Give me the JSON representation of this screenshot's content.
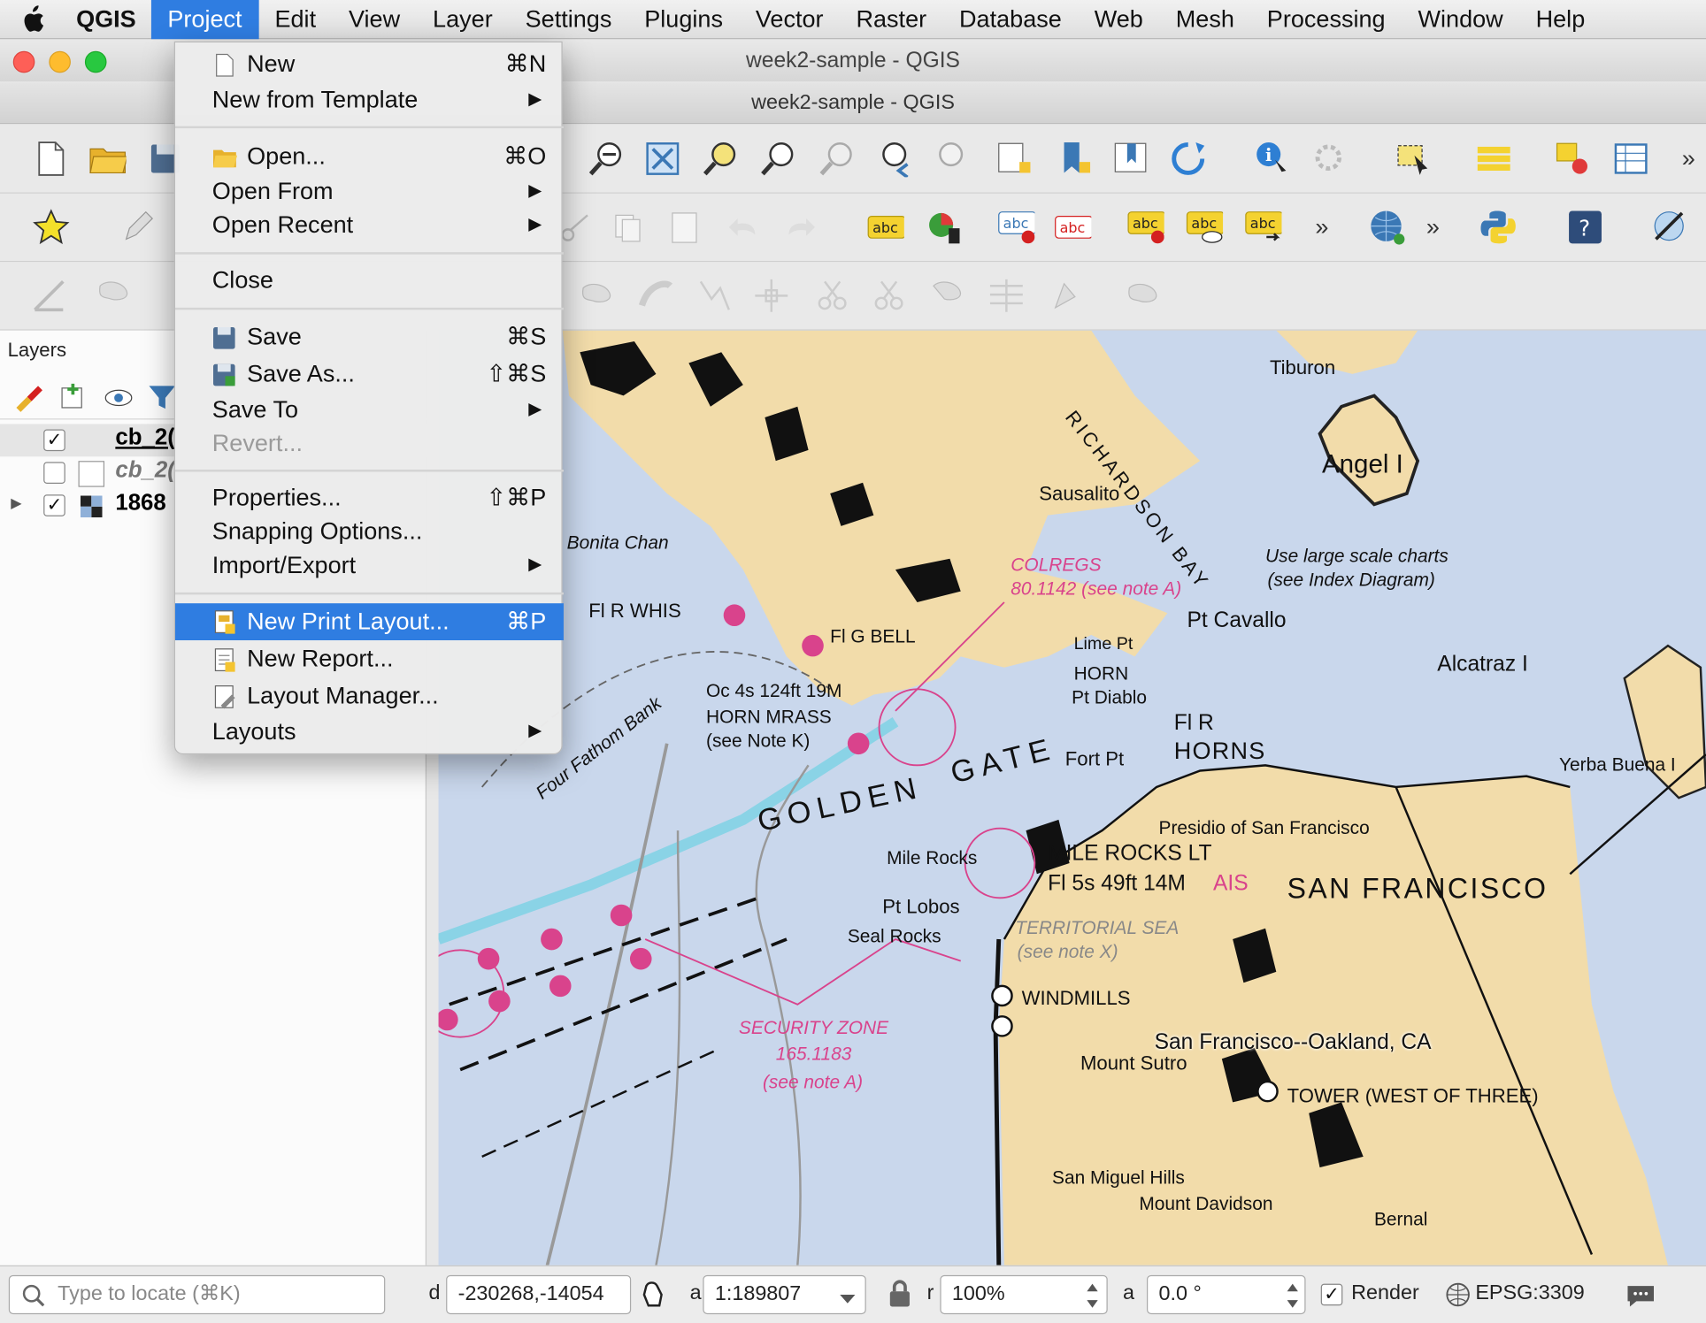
{
  "menubar": {
    "app_name": "QGIS",
    "items": [
      "Project",
      "Edit",
      "View",
      "Layer",
      "Settings",
      "Plugins",
      "Vector",
      "Raster",
      "Database",
      "Web",
      "Mesh",
      "Processing",
      "Window",
      "Help"
    ]
  },
  "window": {
    "title": "week2-sample - QGIS",
    "subtitle": "week2-sample - QGIS"
  },
  "project_menu": {
    "new": {
      "label": "New",
      "shortcut": "⌘N"
    },
    "new_from_template": {
      "label": "New from Template"
    },
    "open": {
      "label": "Open...",
      "shortcut": "⌘O"
    },
    "open_from": {
      "label": "Open From"
    },
    "open_recent": {
      "label": "Open Recent"
    },
    "close": {
      "label": "Close"
    },
    "save": {
      "label": "Save",
      "shortcut": "⌘S"
    },
    "save_as": {
      "label": "Save As...",
      "shortcut": "⇧⌘S"
    },
    "save_to": {
      "label": "Save To"
    },
    "revert": {
      "label": "Revert..."
    },
    "properties": {
      "label": "Properties...",
      "shortcut": "⇧⌘P"
    },
    "snapping": {
      "label": "Snapping Options..."
    },
    "import_export": {
      "label": "Import/Export"
    },
    "new_print_layout": {
      "label": "New Print Layout...",
      "shortcut": "⌘P"
    },
    "new_report": {
      "label": "New Report..."
    },
    "layout_manager": {
      "label": "Layout Manager..."
    },
    "layouts": {
      "label": "Layouts"
    },
    "submenu_arrow": "▶"
  },
  "layers": {
    "title": "Layers",
    "items": [
      {
        "name": "cb_2(",
        "checked": "✓"
      },
      {
        "name": "cb_2(",
        "checked": ""
      },
      {
        "name": "1868",
        "checked": "✓",
        "expander": "▶"
      }
    ]
  },
  "map": {
    "labels": {
      "golden": "GOLDEN",
      "gate": "GATE",
      "sf": "SAN FRANCISCO",
      "place": "San Francisco--Oakland, CA",
      "angel": "Angel I",
      "alcatraz": "Alcatraz I",
      "sausalito": "Sausalito",
      "tiburon": "Tiburon",
      "richardson": "RICHARDSON BAY",
      "pt_cavallo": "Pt Cavallo",
      "horn": "HORN",
      "fi_r_horns_1": "Fl R",
      "fi_r_horns_2": "HORNS",
      "fort_pt": "Fort Pt",
      "mile_rocks": "MILE ROCKS LT",
      "mile_rocks_2": "Fl 5s 49ft 14M",
      "ais": "AIS",
      "presidio": "Presidio of San Francisco",
      "windmills": "WINDMILLS",
      "tower": "TOWER (WEST OF THREE)",
      "mount_sutro": "Mount Sutro",
      "san_miguel": "San Miguel Hills",
      "mount_davidson": "Mount Davidson",
      "bernal": "Bernal",
      "colregs": "COLREGS",
      "colregs_2": "80.1142 (see note A)",
      "territorial": "TERRITORIAL SEA",
      "territorial_2": "(see note X)",
      "security": "SECURITY ZONE",
      "security_2": "165.1183",
      "security_3": "(see note A)",
      "use_large": "Use large scale charts",
      "use_large_2": "(see Index Diagram)",
      "four_fathom": "Four Fathom Bank",
      "bonita": "Bonita Chan",
      "fi_r_whis": "Fl R WHIS",
      "fi_g_bell": "Fl G BELL",
      "horn_mrass": "HORN MRASS",
      "see_note_k": "(see Note K)",
      "oc": "Oc 4s 124ft 19M",
      "pt_lobos": "Pt Lobos",
      "seal_rocks": "Seal Rocks",
      "mile_rocks_lbl": "Mile Rocks",
      "lime_pt": "Lime Pt",
      "pt_diablo": "Pt Diablo",
      "yerba": "Yerba Buena I"
    }
  },
  "statusbar": {
    "locate_placeholder": "Type to locate (⌘K)",
    "coord_prefix": "d",
    "coordinate": "-230268,-14054",
    "scale_prefix": "a",
    "scale": "1:189807",
    "mag_prefix": "r",
    "magnifier": "100%",
    "rot_prefix": "a",
    "rotation": "0.0 °",
    "render_label": "Render",
    "render_checked": "✓",
    "crs": "EPSG:3309"
  }
}
